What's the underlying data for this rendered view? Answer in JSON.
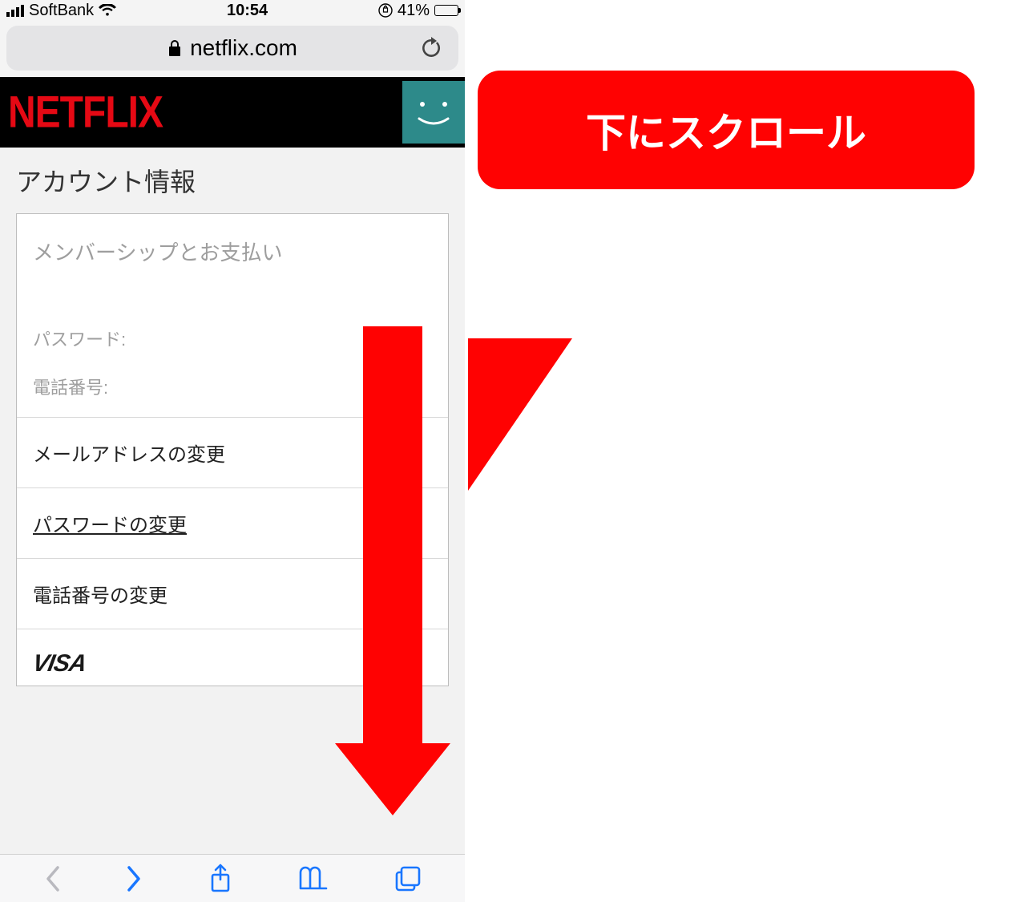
{
  "status_bar": {
    "carrier": "SoftBank",
    "time": "10:54",
    "battery_percent": "41%"
  },
  "browser": {
    "url_label": "netflix.com"
  },
  "header": {
    "brand": "NETFLIX"
  },
  "page": {
    "title": "アカウント情報",
    "section_title": "メンバーシップとお支払い",
    "password_label": "パスワード:",
    "phone_label": "電話番号:",
    "links": {
      "change_email": "メールアドレスの変更",
      "change_password": "パスワードの変更",
      "change_phone": "電話番号の変更"
    },
    "card_brand": "VISA"
  },
  "annotation": {
    "text": "下にスクロール"
  }
}
